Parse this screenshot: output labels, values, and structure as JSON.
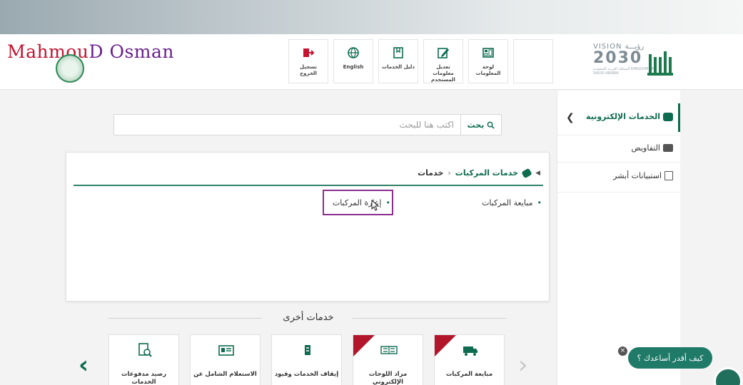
{
  "watermark": {
    "text_part1": "Mahmou",
    "text_part2": "D Osman"
  },
  "header": {
    "buttons": [
      {
        "label": "تسجيل الخروج",
        "icon": "logout-icon"
      },
      {
        "label": "English",
        "icon": "globe-icon"
      },
      {
        "label": "دليل الخدمات",
        "icon": "book-icon"
      },
      {
        "label": "تعديل معلومات المستخدم",
        "icon": "edit-icon"
      },
      {
        "label": "لوحة المعلومات",
        "icon": "dashboard-icon"
      }
    ],
    "vision": {
      "line1": "VISION رؤيـــة",
      "line2": "2030",
      "line3": "المملكة العربية السعودية KINGDOM OF SAUDI ARABIA"
    }
  },
  "sidebar": {
    "items": [
      {
        "label": "الخدمات الإلكترونية",
        "icon": "e-services-icon",
        "active": true
      },
      {
        "label": "التفاويض",
        "icon": "briefcase-icon",
        "active": false
      },
      {
        "label": "استبيانات أبشر",
        "icon": "survey-icon",
        "active": false
      }
    ]
  },
  "search": {
    "button_label": "بحث",
    "placeholder": "اكتب هنا للبحث"
  },
  "breadcrumb": {
    "link": "خدمات المركبات",
    "current": "خدمات"
  },
  "services": {
    "left": "إعارة المركبات",
    "right": "مبايعة المركبات"
  },
  "other": {
    "title": "خدمات أخرى",
    "cards": [
      {
        "label": "رصيد مدفوعات الخدمات",
        "icon": "receipt-search-icon",
        "new": false
      },
      {
        "label": "الاستعلام الشامل عن",
        "icon": "id-card-icon",
        "new": false
      },
      {
        "label": "إيقاف الخدمات وقيود",
        "icon": "stop-services-icon",
        "new": false
      },
      {
        "label": "مزاد اللوحات الإلكتروني",
        "icon": "plate-icon",
        "new": true
      },
      {
        "label": "مبايعة المركبات",
        "icon": "truck-icon",
        "new": true
      }
    ]
  },
  "help": {
    "label": "كيف أقدر أساعدك ؟"
  },
  "colors": {
    "primary": "#0d6b4f",
    "highlight": "#8b2e8e",
    "ribbon": "#b3162b"
  }
}
